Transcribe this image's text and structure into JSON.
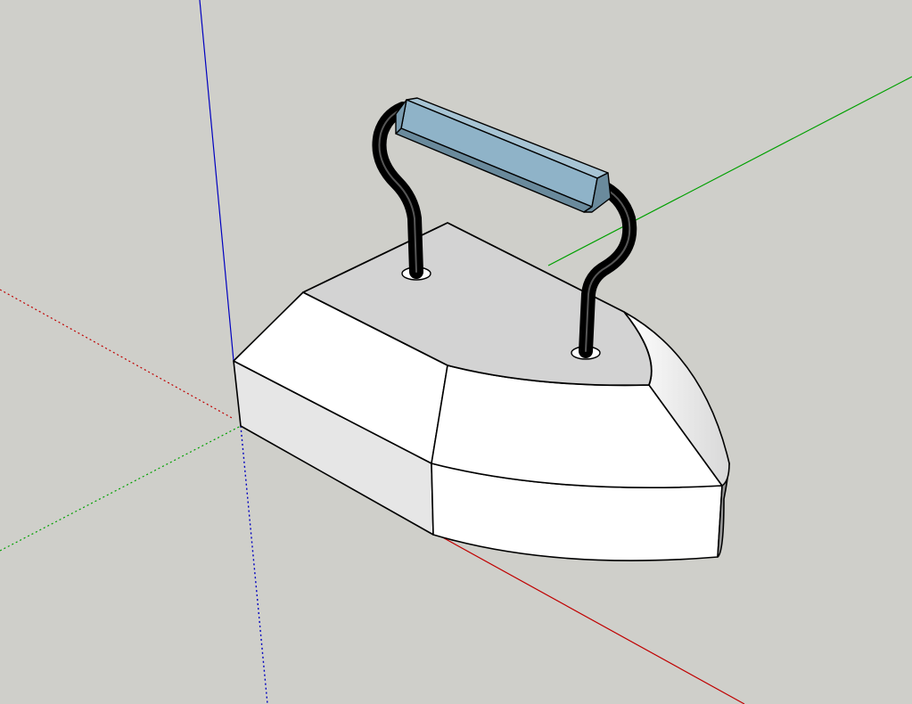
{
  "app": {
    "viewport_background": "#cfcfca"
  },
  "axes": {
    "red_axis_color": "#c00000",
    "green_axis_color": "#00a000",
    "blue_axis_color": "#0000c0"
  },
  "model": {
    "body_face_color": "#ffffff",
    "body_side_color": "#e6e6e6",
    "top_plate_color": "#d3d3d3",
    "handle_grip_color": "#8fb3c8",
    "handle_grip_dark_color": "#6a8a9c",
    "edge_color": "#000000"
  }
}
